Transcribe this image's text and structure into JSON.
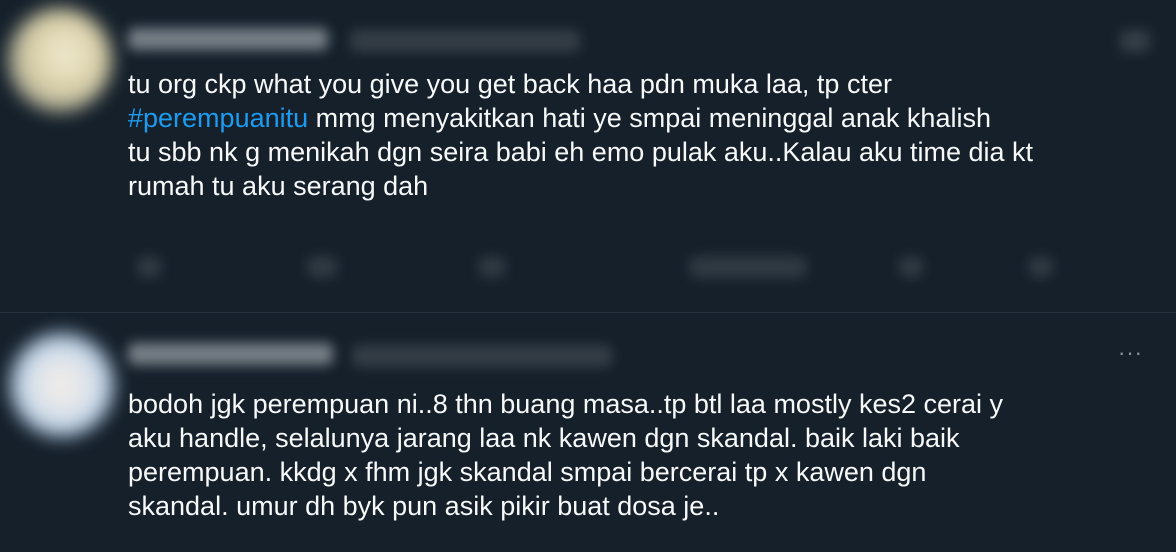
{
  "tweets": [
    {
      "lines": [
        {
          "pre": "tu org ckp what you give you get back haa pdn muka laa, tp cter",
          "hashtag": "",
          "post": ""
        },
        {
          "pre": "",
          "hashtag": "#perempuanitu",
          "post": " mmg menyakitkan hati ye smpai meninggal anak khalish"
        },
        {
          "pre": "tu sbb nk g menikah dgn seira babi eh emo pulak aku..Kalau aku time dia kt",
          "hashtag": "",
          "post": ""
        },
        {
          "pre": "rumah tu aku serang dah",
          "hashtag": "",
          "post": ""
        }
      ]
    },
    {
      "more_label": "···",
      "lines": [
        {
          "pre": "bodoh jgk perempuan ni..8 thn buang masa..tp btl laa mostly kes2 cerai y"
        },
        {
          "pre": "aku handle, selalunya jarang laa nk kawen dgn skandal. baik laki baik"
        },
        {
          "pre": "perempuan. kkdg x fhm jgk skandal smpai bercerai tp x kawen dgn"
        },
        {
          "pre": "skandal. umur dh byk pun asik pikir buat dosa je.."
        }
      ]
    }
  ],
  "colors": {
    "background": "#15202b",
    "text": "#f7f9f9",
    "hashtag": "#1d9bf0",
    "secondary": "#8b98a5"
  }
}
